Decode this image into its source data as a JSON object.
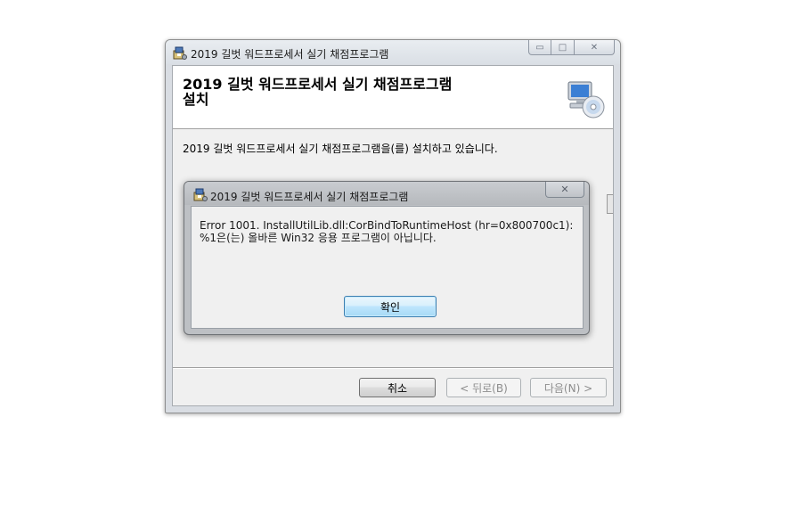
{
  "installer": {
    "title": "2019 길벗 워드프로세서 실기 채점프로그램",
    "banner_title_line1": "2019 길벗 워드프로세서 실기 채점프로그램",
    "banner_title_line2": "설치",
    "status": "2019 길벗 워드프로세서 실기 채점프로그램을(를) 설치하고 있습니다.",
    "buttons": {
      "cancel": "취소",
      "back": "< 뒤로(B)",
      "next": "다음(N) >"
    },
    "window_controls": {
      "minimize": "▭",
      "maximize": "□",
      "close": "✕"
    }
  },
  "error_dialog": {
    "title": "2019 길벗 워드프로세서 실기 채점프로그램",
    "message": "Error 1001. InstallUtilLib.dll:CorBindToRuntimeHost (hr=0x800700c1): %1은(는) 올바른 Win32 응용 프로그램이 아닙니다.",
    "ok_button": "확인",
    "close_glyph": "✕"
  }
}
